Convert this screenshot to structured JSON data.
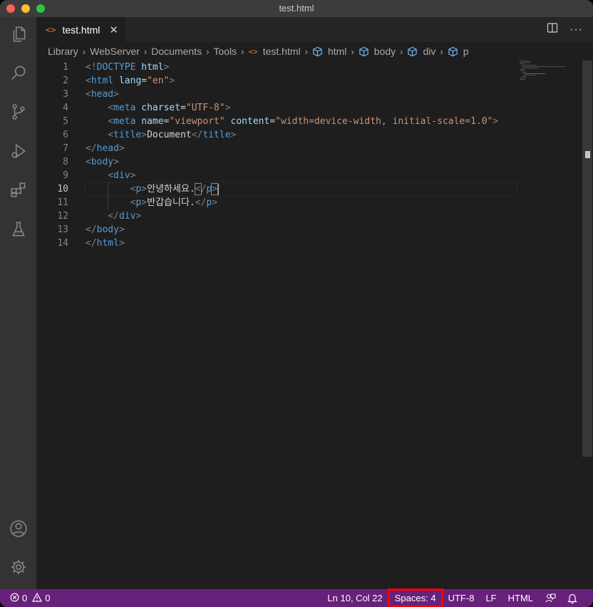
{
  "window": {
    "title": "test.html"
  },
  "activity_bar": {
    "items": [
      "explorer-icon",
      "search-icon",
      "source-control-icon",
      "run-debug-icon",
      "extensions-icon",
      "testing-icon"
    ],
    "bottom": [
      "account-icon",
      "settings-gear-icon"
    ]
  },
  "tab": {
    "label": "test.html",
    "icon": "<>"
  },
  "breadcrumb": [
    "Library",
    "WebServer",
    "Documents",
    "Tools",
    "test.html",
    "html",
    "body",
    "div",
    "p"
  ],
  "editor": {
    "line_numbers": [
      "1",
      "2",
      "3",
      "4",
      "5",
      "6",
      "7",
      "8",
      "9",
      "10",
      "11",
      "12",
      "13",
      "14"
    ],
    "active_line": 10,
    "lines": {
      "l1": {
        "a": "<!",
        "b": "DOCTYPE",
        "c": " html",
        "d": ">"
      },
      "l2": {
        "a": "<",
        "b": "html",
        "c": " lang",
        "d": "=",
        "e": "\"en\"",
        "f": ">"
      },
      "l3": {
        "a": "<",
        "b": "head",
        "c": ">"
      },
      "l4": {
        "a": "<",
        "b": "meta",
        "c": " charset",
        "d": "=",
        "e": "\"UTF-8\"",
        "f": ">"
      },
      "l5": {
        "a": "<",
        "b": "meta",
        "c": " name",
        "d": "=",
        "e": "\"viewport\"",
        "g": " content",
        "h": "=",
        "i": "\"width=device-width, initial-scale=1.0\"",
        "f": ">"
      },
      "l6": {
        "a": "<",
        "b": "title",
        "c": ">",
        "d": "Document",
        "e": "</",
        "f": "title",
        "g": ">"
      },
      "l7": {
        "a": "</",
        "b": "head",
        "c": ">"
      },
      "l8": {
        "a": "<",
        "b": "body",
        "c": ">"
      },
      "l9": {
        "a": "<",
        "b": "div",
        "c": ">"
      },
      "l10": {
        "a": "<",
        "b": "p",
        "c": ">",
        "d": "안녕하세요.",
        "e": "<",
        "f": "/",
        "g": "p",
        "h": ">"
      },
      "l11": {
        "a": "<",
        "b": "p",
        "c": ">",
        "d": "반갑습니다.",
        "e": "</",
        "f": "p",
        "g": ">"
      },
      "l12": {
        "a": "</",
        "b": "div",
        "c": ">"
      },
      "l13": {
        "a": "</",
        "b": "body",
        "c": ">"
      },
      "l14": {
        "a": "</",
        "b": "html",
        "c": ">"
      }
    }
  },
  "status_bar": {
    "errors": "0",
    "warnings": "0",
    "cursor_position": "Ln 10, Col 22",
    "indentation": "Spaces: 4",
    "encoding": "UTF-8",
    "eol": "LF",
    "language": "HTML",
    "colors": {
      "background": "#68217a",
      "highlight": "#ff0000"
    }
  }
}
